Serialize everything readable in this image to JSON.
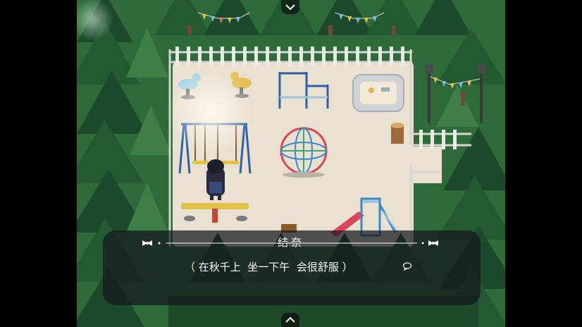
{
  "scene": {
    "location": "playground",
    "colors": {
      "grass": "#2f6b3a",
      "sand": "#e9e1cf",
      "fence": "#d9d6cf",
      "tree_dark": "#1c4a2a",
      "tree_light": "#3d7f46"
    }
  },
  "icons": {
    "top_nav": "chevron-down-icon",
    "bottom_nav": "chevron-up-icon",
    "ornament": "bow-ornament-icon",
    "continue": "speech-bubble-icon"
  },
  "message": {
    "speaker": "结奈",
    "text": "（ 在秋千上  坐一下午  会很舒服 ）"
  }
}
